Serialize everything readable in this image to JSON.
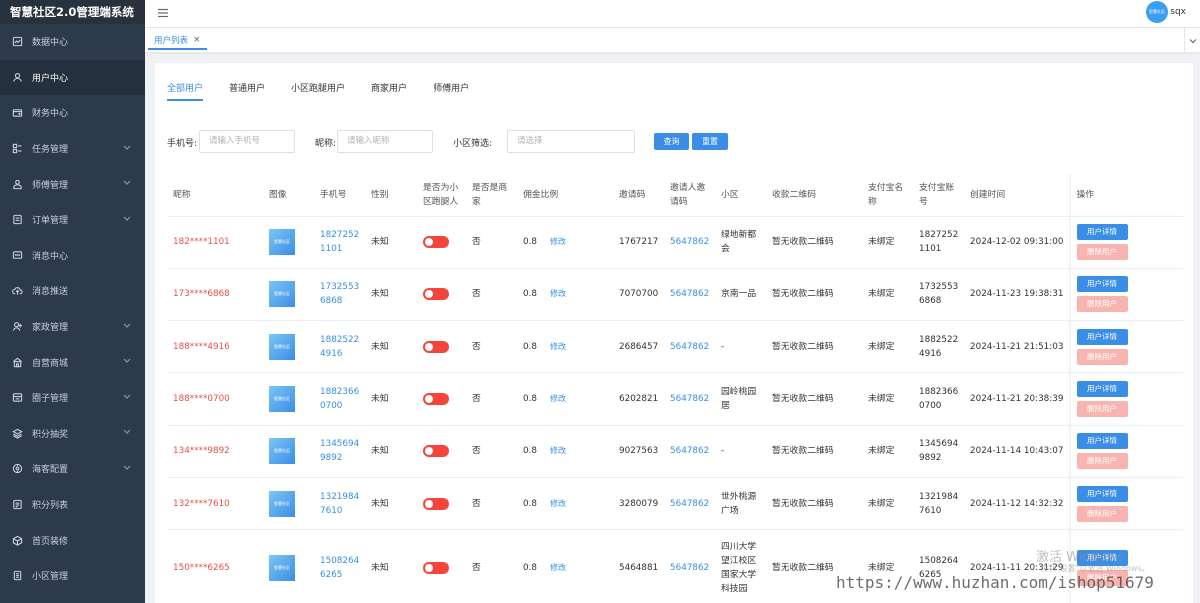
{
  "app": {
    "title": "智慧社区2.0管理端系统"
  },
  "sidebar": {
    "items": [
      {
        "label": "数据中心",
        "icon": "dashboard-icon",
        "expandable": false
      },
      {
        "label": "用户中心",
        "icon": "user-icon",
        "expandable": false,
        "active": true
      },
      {
        "label": "财务中心",
        "icon": "wallet-icon",
        "expandable": false
      },
      {
        "label": "任务管理",
        "icon": "task-icon",
        "expandable": true
      },
      {
        "label": "师傅管理",
        "icon": "worker-icon",
        "expandable": true
      },
      {
        "label": "订单管理",
        "icon": "order-icon",
        "expandable": true
      },
      {
        "label": "消息中心",
        "icon": "message-icon",
        "expandable": false
      },
      {
        "label": "消息推送",
        "icon": "cloud-upload-icon",
        "expandable": false
      },
      {
        "label": "家政管理",
        "icon": "housekeeping-icon",
        "expandable": true
      },
      {
        "label": "自营商城",
        "icon": "store-icon",
        "expandable": true
      },
      {
        "label": "圈子管理",
        "icon": "circle-icon",
        "expandable": true
      },
      {
        "label": "积分抽奖",
        "icon": "lottery-icon",
        "expandable": true
      },
      {
        "label": "海客配置",
        "icon": "config-icon",
        "expandable": true
      },
      {
        "label": "积分列表",
        "icon": "list-icon",
        "expandable": false
      },
      {
        "label": "首页装修",
        "icon": "decorate-icon",
        "expandable": false
      },
      {
        "label": "小区管理",
        "icon": "community-icon",
        "expandable": false
      }
    ]
  },
  "header": {
    "username": "sqx",
    "avatar_text": "智慧社区"
  },
  "tabs": {
    "open": "用户列表",
    "close": "×"
  },
  "subtabs": [
    "全部用户",
    "普通用户",
    "小区跑腿用户",
    "商家用户",
    "师傅用户"
  ],
  "filters": {
    "phone_label": "手机号:",
    "phone_placeholder": "请输入手机号",
    "nick_label": "昵称:",
    "nick_placeholder": "请输入昵称",
    "community_label": "小区筛选:",
    "community_placeholder": "请选择",
    "search": "查询",
    "reset": "重置"
  },
  "table": {
    "headers": {
      "nick": "昵称",
      "image": "图像",
      "phone": "手机号",
      "gender": "性别",
      "runner": "是否为小区跑腿人",
      "merchant": "是否是商家",
      "commission": "佣金比例",
      "code": "邀请码",
      "inviter": "邀请人邀请码",
      "community": "小区",
      "qrcode": "收款二维码",
      "alipay_name": "支付宝名称",
      "alipay_account": "支付宝账号",
      "created": "创建时间",
      "ops": "操作"
    },
    "edit_label": "修改",
    "detail_btn": "用户详情",
    "delete_btn": "删除用户",
    "thumb_text": "智慧社区",
    "rows": [
      {
        "nick": "182****1101",
        "phone": "18272521101",
        "gender": "未知",
        "merchant": "否",
        "commission": "0.8",
        "code": "1767217",
        "inviter": "5647862",
        "community": "绿地新都会",
        "qrcode": "暂无收款二维码",
        "alipay_name": "未绑定",
        "alipay_account": "18272521101",
        "created": "2024-12-02 09:31:00"
      },
      {
        "nick": "173****6868",
        "phone": "17325536868",
        "gender": "未知",
        "merchant": "否",
        "commission": "0.8",
        "code": "7070700",
        "inviter": "5647862",
        "community": "京南一品",
        "qrcode": "暂无收款二维码",
        "alipay_name": "未绑定",
        "alipay_account": "17325536868",
        "created": "2024-11-23 19:38:31"
      },
      {
        "nick": "188****4916",
        "phone": "18825224916",
        "gender": "未知",
        "merchant": "否",
        "commission": "0.8",
        "code": "2686457",
        "inviter": "5647862",
        "community": "-",
        "qrcode": "暂无收款二维码",
        "alipay_name": "未绑定",
        "alipay_account": "18825224916",
        "created": "2024-11-21 21:51:03"
      },
      {
        "nick": "188****0700",
        "phone": "18823660700",
        "gender": "未知",
        "merchant": "否",
        "commission": "0.8",
        "code": "6202821",
        "inviter": "5647862",
        "community": "园岭桃园居",
        "qrcode": "暂无收款二维码",
        "alipay_name": "未绑定",
        "alipay_account": "18823660700",
        "created": "2024-11-21 20:38:39"
      },
      {
        "nick": "134****9892",
        "phone": "13456949892",
        "gender": "未知",
        "merchant": "否",
        "commission": "0.8",
        "code": "9027563",
        "inviter": "5647862",
        "community": "-",
        "qrcode": "暂无收款二维码",
        "alipay_name": "未绑定",
        "alipay_account": "13456949892",
        "created": "2024-11-14 10:43:07"
      },
      {
        "nick": "132****7610",
        "phone": "13219847610",
        "gender": "未知",
        "merchant": "否",
        "commission": "0.8",
        "code": "3280079",
        "inviter": "5647862",
        "community": "世外桃源广场",
        "qrcode": "暂无收款二维码",
        "alipay_name": "未绑定",
        "alipay_account": "13219847610",
        "created": "2024-11-12 14:32:32"
      },
      {
        "nick": "150****6265",
        "phone": "15082646265",
        "gender": "未知",
        "merchant": "否",
        "commission": "0.8",
        "code": "5464881",
        "inviter": "5647862",
        "community": "四川大学望江校区国家大学科技园",
        "qrcode": "暂无收款二维码",
        "alipay_name": "未绑定",
        "alipay_account": "15082646265",
        "created": "2024-11-11 20:31:29"
      }
    ]
  },
  "watermark": {
    "activate": "激活 Windows",
    "activate_sub": "转到\"设置\"以激活 Windows。",
    "site": "https://www.huzhan.com/ishop51679"
  },
  "colors": {
    "sidebar_bg": "#2d3a4b",
    "accent": "#3a8ee6",
    "nick_red": "#e5534b",
    "toggle_on": "#f5453a"
  }
}
